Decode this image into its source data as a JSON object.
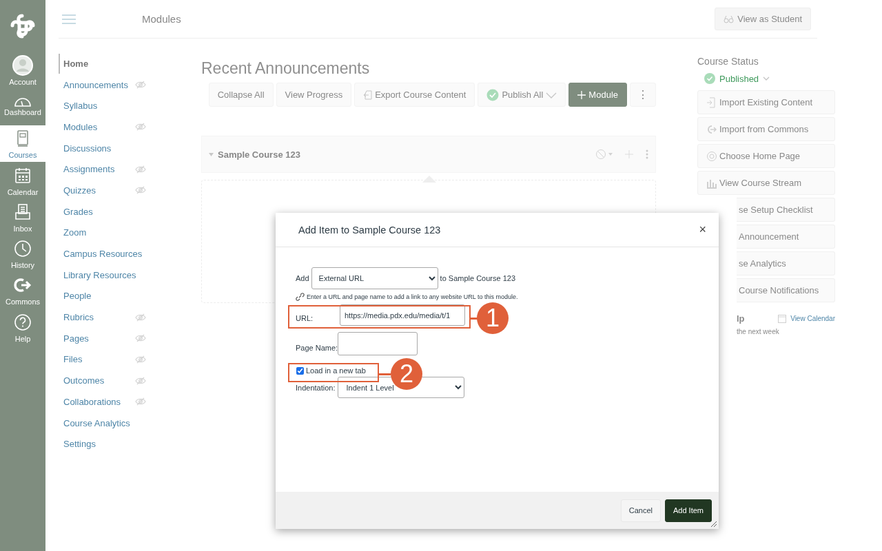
{
  "global_nav": {
    "items": [
      {
        "label": "Account",
        "selected": false
      },
      {
        "label": "Dashboard",
        "selected": false
      },
      {
        "label": "Courses",
        "selected": true
      },
      {
        "label": "Calendar",
        "selected": false
      },
      {
        "label": "Inbox",
        "selected": false
      },
      {
        "label": "History",
        "selected": false
      },
      {
        "label": "Commons",
        "selected": false
      },
      {
        "label": "Help",
        "selected": false
      }
    ]
  },
  "header": {
    "breadcrumb": "Modules",
    "view_as_student": "View as Student"
  },
  "course_nav": {
    "items": [
      {
        "label": "Home",
        "selected": true,
        "visible_to_students": true
      },
      {
        "label": "Announcements",
        "selected": false,
        "visible_to_students": false
      },
      {
        "label": "Syllabus",
        "selected": false,
        "visible_to_students": true
      },
      {
        "label": "Modules",
        "selected": false,
        "visible_to_students": false
      },
      {
        "label": "Discussions",
        "selected": false,
        "visible_to_students": true
      },
      {
        "label": "Assignments",
        "selected": false,
        "visible_to_students": false
      },
      {
        "label": "Quizzes",
        "selected": false,
        "visible_to_students": false
      },
      {
        "label": "Grades",
        "selected": false,
        "visible_to_students": true
      },
      {
        "label": "Zoom",
        "selected": false,
        "visible_to_students": true
      },
      {
        "label": "Campus Resources",
        "selected": false,
        "visible_to_students": true
      },
      {
        "label": "Library Resources",
        "selected": false,
        "visible_to_students": true
      },
      {
        "label": "People",
        "selected": false,
        "visible_to_students": true
      },
      {
        "label": "Rubrics",
        "selected": false,
        "visible_to_students": false
      },
      {
        "label": "Pages",
        "selected": false,
        "visible_to_students": false
      },
      {
        "label": "Files",
        "selected": false,
        "visible_to_students": false
      },
      {
        "label": "Outcomes",
        "selected": false,
        "visible_to_students": false
      },
      {
        "label": "Collaborations",
        "selected": false,
        "visible_to_students": false
      },
      {
        "label": "Course Analytics",
        "selected": false,
        "visible_to_students": true
      },
      {
        "label": "Settings",
        "selected": false,
        "visible_to_students": true
      }
    ]
  },
  "content": {
    "title": "Recent Announcements",
    "toolbar": [
      {
        "label": "Collapse All",
        "kind": "plain"
      },
      {
        "label": "View Progress",
        "kind": "plain"
      },
      {
        "label": "Export Course Content",
        "kind": "export"
      },
      {
        "label": "Publish All",
        "kind": "publish"
      },
      {
        "label": "Module",
        "kind": "add"
      },
      {
        "label": "⋮",
        "kind": "menu"
      }
    ],
    "module": {
      "name": "Sample Course 123"
    }
  },
  "sidebar": {
    "heading": "Course Status",
    "status": "Published",
    "actions": [
      {
        "label": "Import Existing Content",
        "kind": "import"
      },
      {
        "label": "Import from Commons",
        "kind": "commons"
      },
      {
        "label": "Choose Home Page",
        "kind": "home"
      },
      {
        "label": "View Course Stream",
        "kind": "stream"
      },
      {
        "label": "se Setup Checklist",
        "kind": "clipped"
      },
      {
        "label": "Announcement",
        "kind": "clipped"
      },
      {
        "label": "se Analytics",
        "kind": "clipped"
      },
      {
        "label": "Course Notifications",
        "kind": "clipped"
      }
    ],
    "todo_heading": "lp",
    "view_calendar": "View Calendar",
    "todo_note": "the next week"
  },
  "dialog": {
    "title": "Add Item to Sample Course 123",
    "close": "×",
    "add_label": "Add",
    "item_type": "External URL",
    "target": "to Sample Course 123",
    "hint": "Enter a URL and page name to add a link to any website URL to this module.",
    "url_label": "URL:",
    "url_value": "https://media.pdx.edu/media/t/1",
    "page_name_label": "Page Name:",
    "new_tab_label": "Load in a new tab",
    "new_tab_checked": true,
    "indentation_label": "Indentation:",
    "indentation": "Indent 1 Level",
    "buttons": [
      {
        "label": "Cancel",
        "kind": "secondary"
      },
      {
        "label": "Add Item",
        "kind": "primary"
      }
    ]
  },
  "callouts": [
    {
      "number": "1"
    },
    {
      "number": "2"
    }
  ]
}
